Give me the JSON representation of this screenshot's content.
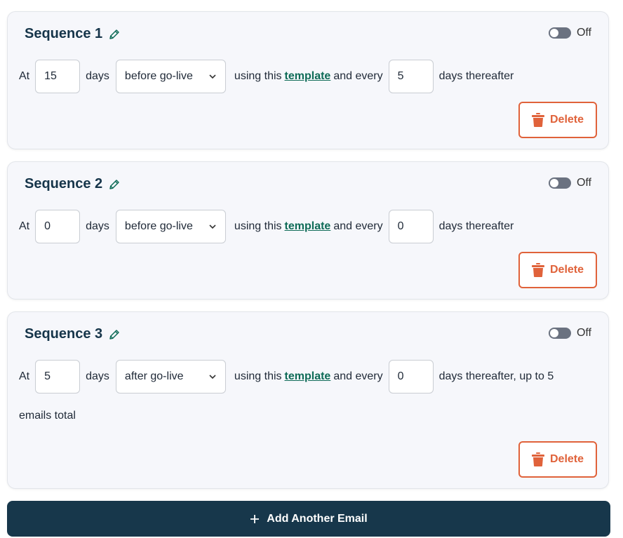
{
  "colors": {
    "title": "#16354a",
    "link": "#0e6b57",
    "danger": "#e0623a",
    "primary_button": "#17374b",
    "card_bg": "#f6f7fb"
  },
  "labels": {
    "at": "At",
    "days": "days",
    "using_this": "using this",
    "template": "template",
    "and_every": "and every",
    "days_thereafter": "days thereafter",
    "delete": "Delete"
  },
  "sequences": [
    {
      "title": "Sequence 1",
      "toggle": "Off",
      "at_value": "15",
      "timing": "before go-live",
      "every_value": "5",
      "suffix": "days thereafter"
    },
    {
      "title": "Sequence 2",
      "toggle": "Off",
      "at_value": "0",
      "timing": "before go-live",
      "every_value": "0",
      "suffix": "days thereafter"
    },
    {
      "title": "Sequence 3",
      "toggle": "Off",
      "at_value": "5",
      "timing": "after go-live",
      "every_value": "0",
      "suffix": "days thereafter, up to 5",
      "suffix_wrap": "emails total"
    }
  ],
  "add_button": "Add Another Email",
  "icons": {
    "edit": "pencil-icon",
    "toggle": "toggle-switch",
    "dropdown": "chevron-down-icon",
    "delete": "trash-icon",
    "add": "plus-icon"
  }
}
